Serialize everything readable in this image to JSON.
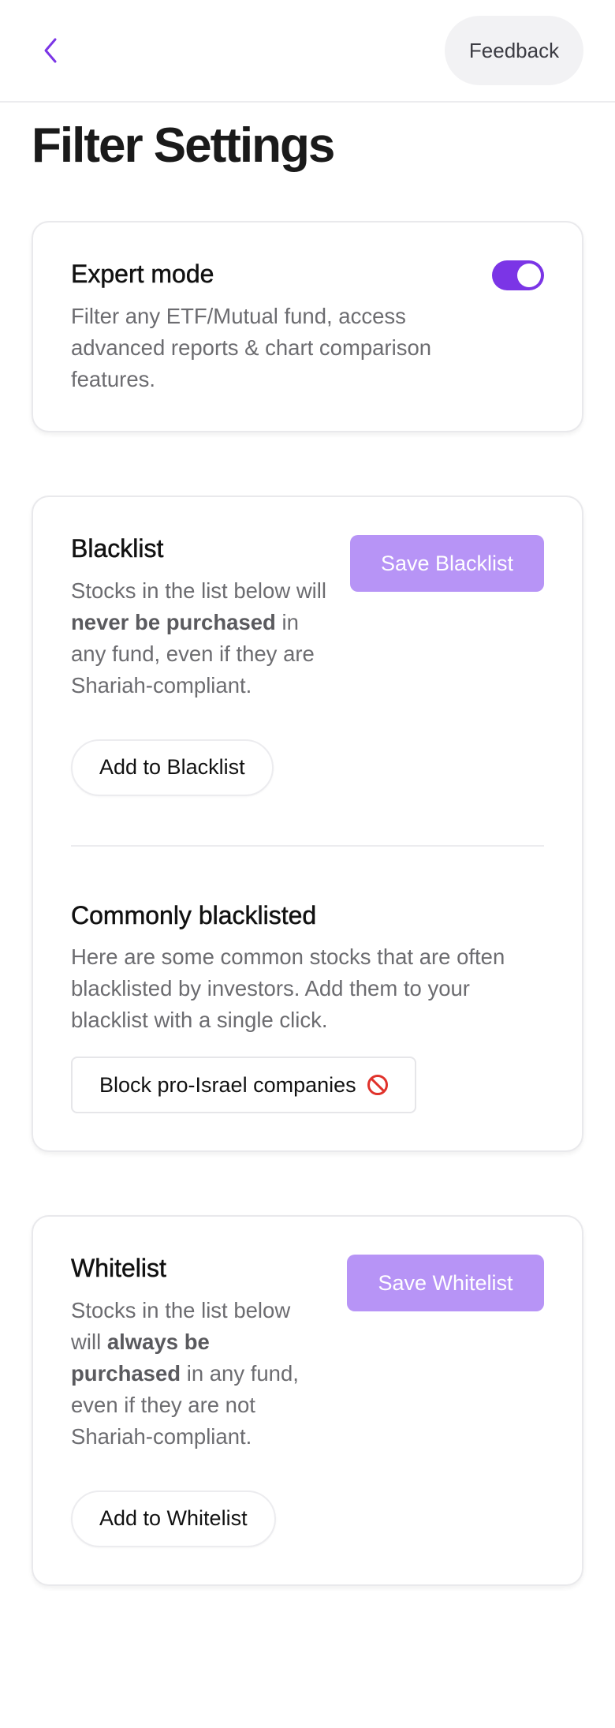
{
  "header": {
    "back_icon": "chevron-left-icon",
    "feedback_label": "Feedback"
  },
  "page": {
    "title": "Filter Settings"
  },
  "expert": {
    "title": "Expert mode",
    "description": "Filter any ETF/Mutual fund, access advanced reports & chart comparison features.",
    "enabled": true,
    "toggle_color": "#7b35e6"
  },
  "blacklist": {
    "title": "Blacklist",
    "save_label": "Save Blacklist",
    "desc_line1": "Stocks in the list below will",
    "desc_bold": "never be purchased",
    "desc_line2": "in any fund, even if they are Shariah-compliant.",
    "add_label": "Add to Blacklist",
    "common_title": "Commonly blacklisted",
    "common_description": "Here are some common stocks that are often blacklisted by investors. Add them to your blacklist with a single click.",
    "block_label": "Block pro-Israel companies",
    "block_icon": "no-entry-icon"
  },
  "whitelist": {
    "title": "Whitelist",
    "save_label": "Save Whitelist",
    "desc_line1": "Stocks in the list below will",
    "desc_bold": "always be purchased",
    "desc_line2": "in any fund, even if they are not Shariah-compliant.",
    "add_label": "Add to Whitelist"
  },
  "colors": {
    "accent": "#7b35e6",
    "save_button": "#b794f6"
  }
}
